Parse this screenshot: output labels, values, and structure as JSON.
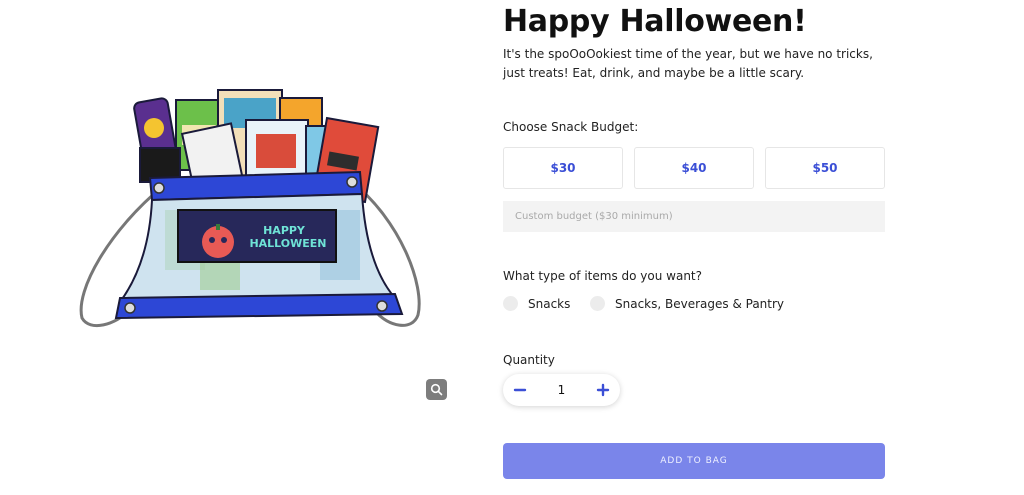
{
  "product": {
    "title": "Happy Halloween!",
    "description": "It's the spoOoOokiest time of the year, but we have no tricks, just treats! Eat, drink, and maybe be a little scary.",
    "banner_line1": "HAPPY",
    "banner_line2": "HALLOWEEN"
  },
  "budget": {
    "label": "Choose Snack Budget:",
    "options": [
      "$30",
      "$40",
      "$50"
    ],
    "custom_placeholder": "Custom budget ($30 minimum)"
  },
  "items_type": {
    "label": "What type of items do you want?",
    "options": [
      "Snacks",
      "Snacks, Beverages & Pantry"
    ]
  },
  "quantity": {
    "label": "Quantity",
    "value": "1"
  },
  "cart": {
    "add_label": "ADD TO BAG"
  },
  "colors": {
    "accent": "#3b4fd6",
    "add_button": "#7a85ea",
    "bag_blue": "#2d47d6"
  }
}
